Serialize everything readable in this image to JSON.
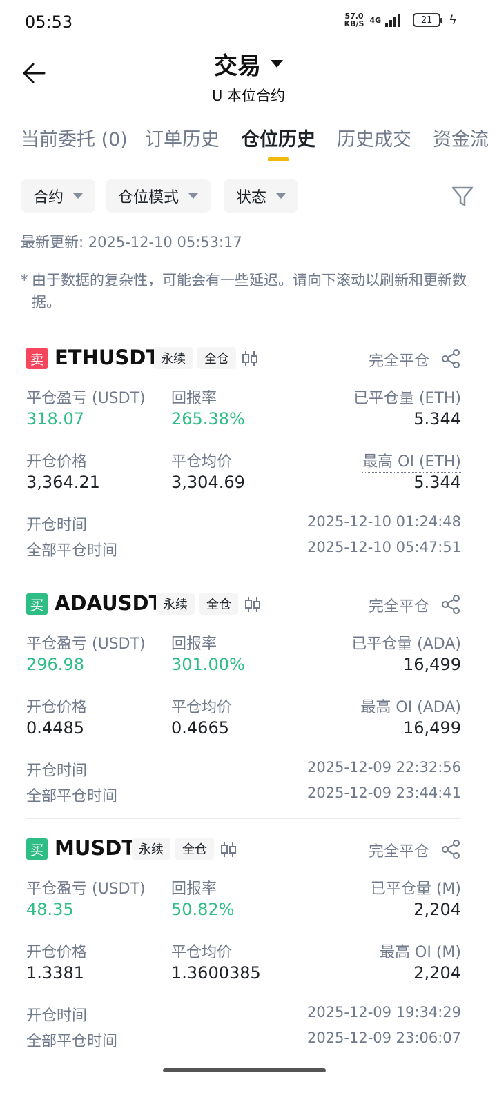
{
  "status_bar": {
    "time": "05:53",
    "net_speed_value": "57.0",
    "net_speed_unit": "KB/S",
    "network": "4G",
    "battery": "21"
  },
  "header": {
    "title": "交易",
    "subtitle": "U 本位合约"
  },
  "tabs": [
    {
      "label": "当前委托 (0)",
      "active": false
    },
    {
      "label": "订单历史",
      "active": false
    },
    {
      "label": "仓位历史",
      "active": true
    },
    {
      "label": "历史成交",
      "active": false
    },
    {
      "label": "资金流",
      "active": false
    }
  ],
  "filters": [
    {
      "label": "合约"
    },
    {
      "label": "仓位模式"
    },
    {
      "label": "状态"
    }
  ],
  "last_updated": "最新更新: 2025-12-10 05:53:17",
  "notice": {
    "star": "*",
    "text": "由于数据的复杂性，可能会有一些延迟。请向下滚动以刷新和更新数据。"
  },
  "labels": {
    "pnl": "平仓盈亏 (USDT)",
    "roi": "回报率",
    "entry_price": "开仓价格",
    "avg_close_price": "平仓均价",
    "open_time": "开仓时间",
    "close_time": "全部平仓时间"
  },
  "positions": [
    {
      "side": "卖",
      "side_type": "sell",
      "symbol": "ETHUSDT",
      "tag_type": "永续",
      "tag_margin": "全仓",
      "status": "完全平仓",
      "pnl": "318.07",
      "roi": "265.38%",
      "closed_qty_label": "已平仓量 (ETH)",
      "closed_qty": "5.344",
      "entry_price": "3,364.21",
      "avg_close_price": "3,304.69",
      "max_oi_label": "最高 OI (ETH)",
      "max_oi": "5.344",
      "open_time": "2025-12-10 01:24:48",
      "close_time": "2025-12-10 05:47:51"
    },
    {
      "side": "买",
      "side_type": "buy",
      "symbol": "ADAUSDT",
      "tag_type": "永续",
      "tag_margin": "全仓",
      "status": "完全平仓",
      "pnl": "296.98",
      "roi": "301.00%",
      "closed_qty_label": "已平仓量 (ADA)",
      "closed_qty": "16,499",
      "entry_price": "0.4485",
      "avg_close_price": "0.4665",
      "max_oi_label": "最高 OI (ADA)",
      "max_oi": "16,499",
      "open_time": "2025-12-09 22:32:56",
      "close_time": "2025-12-09 23:44:41"
    },
    {
      "side": "买",
      "side_type": "buy",
      "symbol": "MUSDT",
      "tag_type": "永续",
      "tag_margin": "全仓",
      "status": "完全平仓",
      "pnl": "48.35",
      "roi": "50.82%",
      "closed_qty_label": "已平仓量 (M)",
      "closed_qty": "2,204",
      "entry_price": "1.3381",
      "avg_close_price": "1.3600385",
      "max_oi_label": "最高 OI (M)",
      "max_oi": "2,204",
      "open_time": "2025-12-09 19:34:29",
      "close_time": "2025-12-09 23:06:07"
    }
  ],
  "colors": {
    "accent": "#f0b90b",
    "profit": "#2ebd85",
    "sell": "#f6465d",
    "buy": "#2ebd85",
    "secondary_text": "#707a8a"
  }
}
